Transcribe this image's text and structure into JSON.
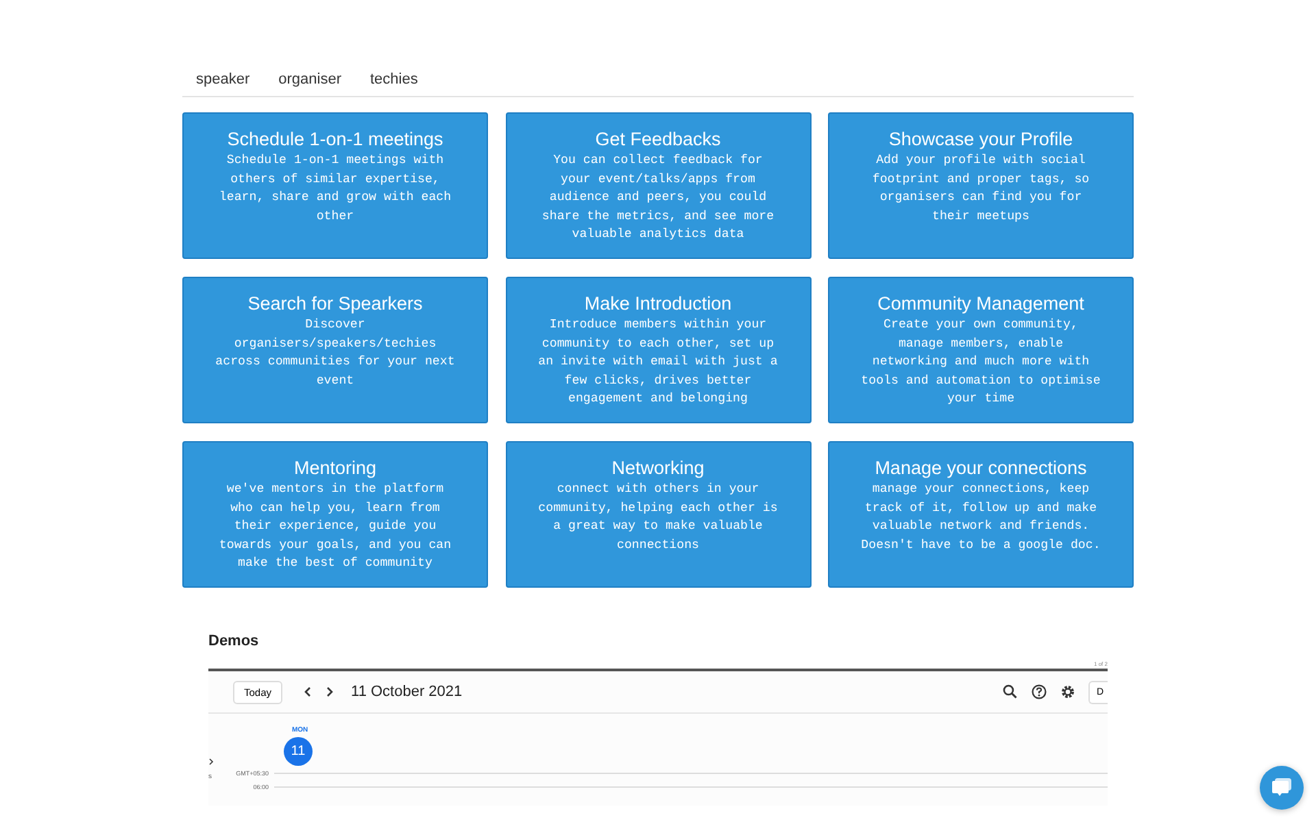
{
  "tabs": [
    {
      "label": "speaker"
    },
    {
      "label": "organiser"
    },
    {
      "label": "techies"
    }
  ],
  "features": [
    {
      "title": "Schedule 1-on-1 meetings",
      "text": "Schedule 1-on-1 meetings with others of similar expertise, learn, share and grow with each other"
    },
    {
      "title": "Get Feedbacks",
      "text": "You can collect feedback for your event/talks/apps from audience and peers, you could share the metrics, and see more valuable analytics data"
    },
    {
      "title": "Showcase your Profile",
      "text": "Add your profile with social footprint and proper tags, so organisers can find you for their meetups"
    },
    {
      "title": "Search for Spearkers",
      "text": "Discover organisers/speakers/techies across communities for your next event"
    },
    {
      "title": "Make Introduction",
      "text": "Introduce members within your community to each other, set up an invite with email with just a few clicks, drives better engagement and belonging"
    },
    {
      "title": "Community Management",
      "text": "Create your own community, manage members, enable networking and much more with tools and automation to optimise your time"
    },
    {
      "title": "Mentoring",
      "text": "we've mentors in the platform who can help you, learn from their experience, guide you towards your goals, and you can make the best of community"
    },
    {
      "title": "Networking",
      "text": "connect with others in your community, helping each other is a great way to make valuable connections"
    },
    {
      "title": "Manage your connections",
      "text": "manage your connections, keep track of it, follow up and make valuable network and friends. Doesn't have to be a google doc."
    }
  ],
  "demos": {
    "heading": "Demos",
    "page_count": "1 of 2",
    "calendar": {
      "today_button": "Today",
      "date": "11 October 2021",
      "view_button": "D",
      "day_name": "MON",
      "day_number": "11",
      "timezone": "GMT+05:30",
      "times": [
        "06:00"
      ],
      "side_text": "s"
    }
  }
}
